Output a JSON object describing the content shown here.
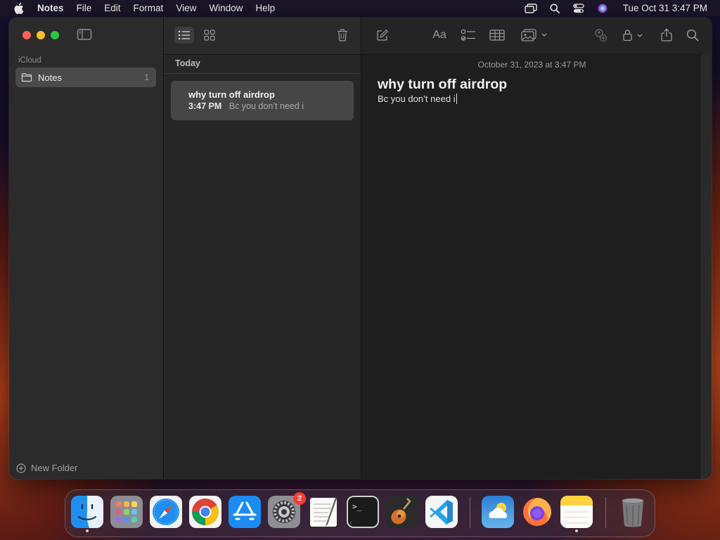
{
  "menubar": {
    "app_name": "Notes",
    "menus": [
      "File",
      "Edit",
      "Format",
      "View",
      "Window",
      "Help"
    ],
    "status_icons": [
      "screen-mirroring-icon",
      "spotlight-search-icon",
      "control-center-icon",
      "siri-icon"
    ],
    "clock": "Tue Oct 31  3:47 PM"
  },
  "sidebar": {
    "section": "iCloud",
    "folders": [
      {
        "name": "Notes",
        "count": "1",
        "icon": "folder-icon"
      }
    ],
    "new_folder_label": "New Folder"
  },
  "note_list": {
    "view_modes": [
      "list-view-icon",
      "gallery-view-icon"
    ],
    "section": "Today",
    "notes": [
      {
        "title": "why turn off airdrop",
        "time": "3:47 PM",
        "preview": "Bc you don’t need i"
      }
    ]
  },
  "editor": {
    "toolbar_icons": [
      "compose-icon",
      "text-format-icon",
      "checklist-icon",
      "table-icon",
      "media-icon",
      "collaborate-icon",
      "lock-icon",
      "share-icon",
      "search-icon"
    ],
    "format_label": "Aa",
    "date": "October 31, 2023 at 3:47 PM",
    "heading": "why turn off airdrop",
    "body": "Bc you don’t need i"
  },
  "dock": {
    "apps": [
      {
        "name": "Finder",
        "running": true
      },
      {
        "name": "Launchpad",
        "running": false
      },
      {
        "name": "Safari",
        "running": false
      },
      {
        "name": "Google Chrome",
        "running": false
      },
      {
        "name": "App Store",
        "running": false
      },
      {
        "name": "System Settings",
        "running": false,
        "badge": "2"
      },
      {
        "name": "TextEdit",
        "running": false
      },
      {
        "name": "Terminal",
        "running": false
      },
      {
        "name": "GarageBand",
        "running": false
      },
      {
        "name": "Visual Studio Code",
        "running": false
      },
      {
        "name": "Weather",
        "running": false
      },
      {
        "name": "Firefox",
        "running": false
      },
      {
        "name": "Notes",
        "running": true
      },
      {
        "name": "Trash",
        "running": false
      }
    ],
    "terminal_prompt": ">_"
  }
}
